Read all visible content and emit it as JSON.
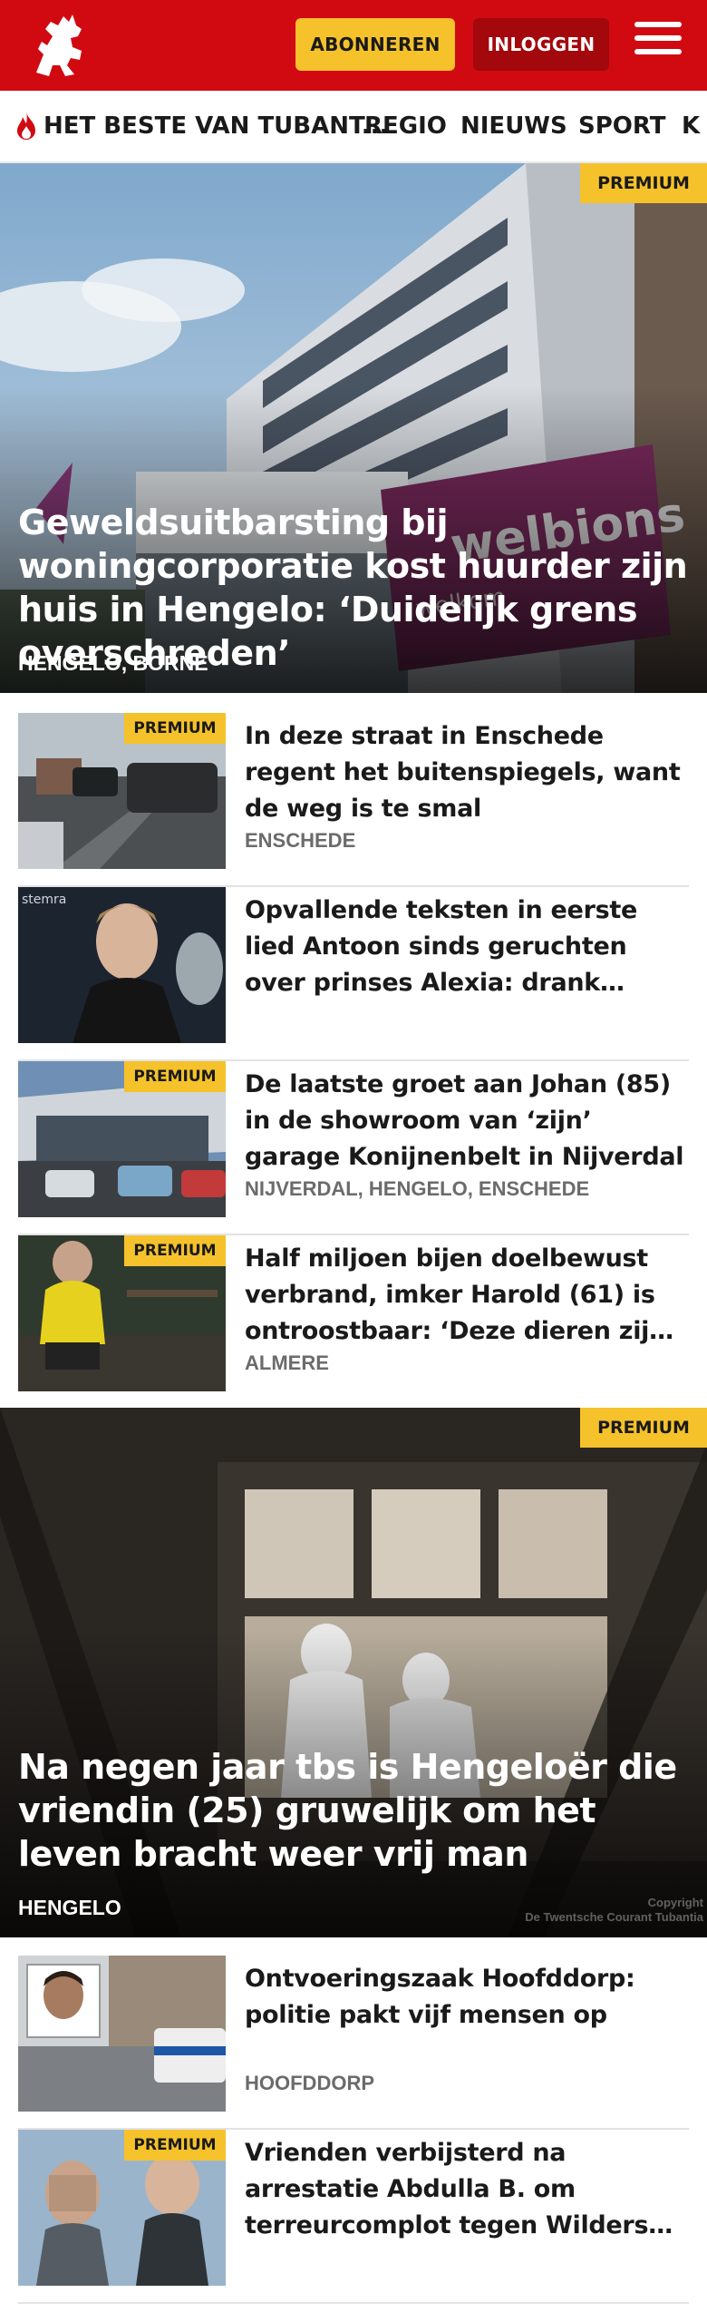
{
  "header": {
    "subscribe_label": "ABONNEREN",
    "login_label": "INLOGGEN",
    "brand_color": "#d10a11",
    "accent_color": "#f5c22b"
  },
  "nav": {
    "items": [
      "HET BESTE VAN TUBANT...",
      "REGIO",
      "NIEUWS",
      "SPORT",
      "K"
    ]
  },
  "hero1": {
    "premium": "PREMIUM",
    "title": "Geweldsuitbarsting bij woningcorpo­ratie kost huurder zijn huis in Hengelo: ‘Duidelijk grens overschreden’",
    "location": "HENGELO, BORNE",
    "sign_text": "welbions",
    "sign_sub": "welkom"
  },
  "articles": [
    {
      "premium": "PREMIUM",
      "title": "In deze straat in Enschede regent het buitenspiegels, want de weg is te smal",
      "location": "ENSCHEDE"
    },
    {
      "premium": "",
      "title": "Opvallende teksten in eerste lied Antoon sinds geruchten over prinses Alexia: drank speelt de hoofdrol",
      "location": "",
      "backdrop_text": "stemra"
    },
    {
      "premium": "PREMIUM",
      "title": "De laatste groet aan Johan (85) in de showroom van ‘zijn’ garage Konijnenbelt in Nijverdal",
      "location": "NIJVERDAL, HENGELO, ENSCHEDE"
    },
    {
      "premium": "PREMIUM",
      "title": "Half miljoen bijen doelbewust verbrand, imker Harold (61) is ontroostbaar: ‘Deze dieren zijn mijn leven’",
      "location": "ALMERE"
    }
  ],
  "hero2": {
    "premium": "PREMIUM",
    "title": "Na negen jaar tbs is Hengeloër die vriendin (25) gruwelijk om het leven bracht weer vrij man",
    "location": "HENGELO",
    "copyright": "Copyright\nDe Twentsche Courant Tubantia"
  },
  "articles2": [
    {
      "premium": "",
      "title": "Ontvoeringszaak Hoofddorp: politie pakt vijf mensen op",
      "location": "HOOFDDORP"
    },
    {
      "premium": "PREMIUM",
      "title": "Vrienden verbijsterd na arrestatie Abdulla B. om terreurcomplot tegen Wilders en Kaag",
      "location": ""
    }
  ]
}
